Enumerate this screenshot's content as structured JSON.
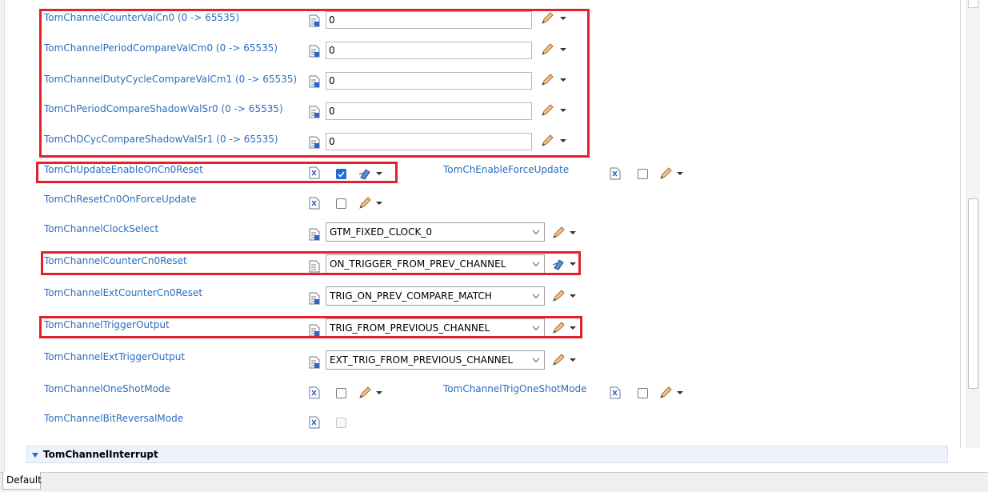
{
  "rows": {
    "counter_val": {
      "label": "TomChannelCounterValCn0 (0 -> 65535)",
      "value": "0"
    },
    "period_compare": {
      "label": "TomChannelPeriodCompareValCm0 (0 -> 65535)",
      "value": "0"
    },
    "duty_compare": {
      "label": "TomChannelDutyCycleCompareValCm1 (0 -> 65535)",
      "value": "0"
    },
    "period_shadow": {
      "label": "TomChPeriodCompareShadowValSr0 (0 -> 65535)",
      "value": "0"
    },
    "dcyc_shadow": {
      "label": "TomChDCycCompareShadowValSr1 (0 -> 65535)",
      "value": "0"
    },
    "update_enable": {
      "label": "TomChUpdateEnableOnCn0Reset",
      "checked": true
    },
    "force_update": {
      "label": "TomChEnableForceUpdate",
      "checked": false
    },
    "reset_cn0": {
      "label": "TomChResetCn0OnForceUpdate",
      "checked": false
    },
    "clock_select": {
      "label": "TomChannelClockSelect",
      "value": "GTM_FIXED_CLOCK_0"
    },
    "counter_reset": {
      "label": "TomChannelCounterCn0Reset",
      "value": "ON_TRIGGER_FROM_PREV_CHANNEL"
    },
    "ext_counter_reset": {
      "label": "TomChannelExtCounterCn0Reset",
      "value": "TRIG_ON_PREV_COMPARE_MATCH"
    },
    "trigger_output": {
      "label": "TomChannelTriggerOutput",
      "value": "TRIG_FROM_PREVIOUS_CHANNEL"
    },
    "ext_trigger_output": {
      "label": "TomChannelExtTriggerOutput",
      "value": "EXT_TRIG_FROM_PREVIOUS_CHANNEL"
    },
    "one_shot": {
      "label": "TomChannelOneShotMode",
      "checked": false
    },
    "trig_one_shot": {
      "label": "TomChannelTrigOneShotMode",
      "checked": false
    },
    "bit_reversal": {
      "label": "TomChannelBitReversalMode",
      "checked": false,
      "disabled": true
    }
  },
  "section": {
    "title": "TomChannelInterrupt"
  },
  "bottom_tab": {
    "label": "Default"
  },
  "colors": {
    "label_blue": "#2a6ebb",
    "highlight_red": "#e3202c",
    "checkbox_blue": "#1f6fd0"
  },
  "icons": {
    "config_icon": "config-parameter-icon",
    "edit_icon": "pencil-icon",
    "calc_icon": "calculated-value-icon",
    "menu_icon": "dropdown-arrow-icon"
  }
}
